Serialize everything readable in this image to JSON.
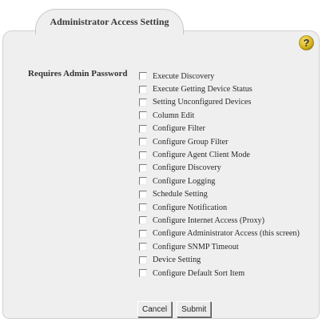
{
  "tab": {
    "label": "Administrator Access Setting"
  },
  "help": {
    "icon": "help-icon",
    "glyph": "?",
    "color": "#d6b316"
  },
  "form": {
    "requires_label": "Requires Admin Password",
    "options": [
      {
        "label": "Execute Discovery",
        "checked": false
      },
      {
        "label": "Execute Getting Device Status",
        "checked": false
      },
      {
        "label": "Setting Unconfigured Devices",
        "checked": false
      },
      {
        "label": "Column Edit",
        "checked": false
      },
      {
        "label": "Configure Filter",
        "checked": false
      },
      {
        "label": "Configure Group Filter",
        "checked": false
      },
      {
        "label": "Configure Agent Client Mode",
        "checked": false
      },
      {
        "label": "Configure Discovery",
        "checked": false
      },
      {
        "label": "Configure Logging",
        "checked": false
      },
      {
        "label": "Schedule Setting",
        "checked": false
      },
      {
        "label": "Configure Notification",
        "checked": false
      },
      {
        "label": "Configure Internet Access (Proxy)",
        "checked": false
      },
      {
        "label": "Configure Administrator Access (this screen)",
        "checked": false
      },
      {
        "label": "Configure SNMP Timeout",
        "checked": false
      },
      {
        "label": "Device Setting",
        "checked": false
      },
      {
        "label": "Configure Default Sort Item",
        "checked": false
      }
    ]
  },
  "buttons": {
    "cancel_label": "Cancel",
    "submit_label": "Submit"
  },
  "colors": {
    "panel_bg": "#efefef",
    "tab_bg": "#efefef",
    "border": "#c8c8c8"
  }
}
